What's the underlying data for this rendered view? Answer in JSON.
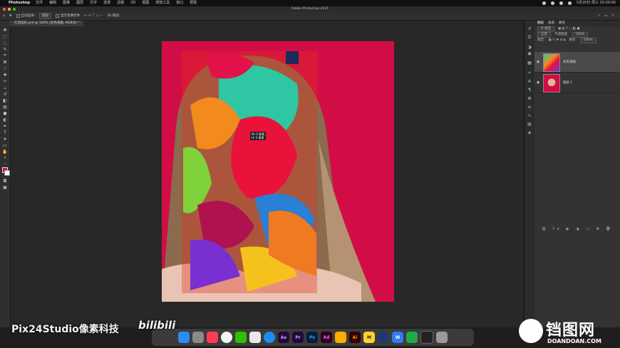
{
  "menubar": {
    "app_name": "Photoshop",
    "items": [
      "文件",
      "编辑",
      "图像",
      "图层",
      "文字",
      "选择",
      "滤镜",
      "3D",
      "视图",
      "增效工具",
      "窗口",
      "帮助"
    ],
    "clock": "5月20日 周三 20:00:00"
  },
  "window": {
    "title": "Adobe Photoshop 2021"
  },
  "options_bar": {
    "auto_select_label": "自动选择:",
    "auto_select_value": "图层",
    "show_transform_label": "显示变换控件",
    "mode_3d_label": "3D 模式:"
  },
  "document_tab": {
    "label": "打造炫彩.psd @ 100% (彩色海报, RGB/8) *"
  },
  "canvas": {
    "tooltip_line1": "W: 0 像素",
    "tooltip_line2": "H: 0 像素",
    "background_color": "#d20d45"
  },
  "layers_panel": {
    "tabs": [
      "图层",
      "通道",
      "路径"
    ],
    "kind_filter": "Q 类型",
    "blend_mode": "正常",
    "opacity_label": "不透明度:",
    "opacity_value": "100%",
    "lock_label": "锁定:",
    "fill_label": "填充:",
    "fill_value": "100%",
    "layers": [
      {
        "name": "彩色海报",
        "selected": true
      },
      {
        "name": "图层 1",
        "selected": false
      }
    ]
  },
  "dock": {
    "apps": [
      "finder-icon",
      "launchpad-icon",
      "music-icon",
      "chrome-icon",
      "wechat-icon",
      "qq-icon",
      "safari-icon",
      "after-effects-icon",
      "premiere-icon",
      "photoshop-icon",
      "xd-icon",
      "sketch-icon",
      "illustrator-icon",
      "miro-icon",
      "cinema4d-icon",
      "wps-icon",
      "camtasia-icon",
      "terminal-icon",
      "trash-icon"
    ],
    "labels": [
      "",
      "",
      "",
      "",
      "",
      "",
      "",
      "Ae",
      "Pr",
      "Ps",
      "Xd",
      "",
      "Ai",
      "M",
      "",
      "W",
      "",
      "",
      ""
    ]
  },
  "watermarks": {
    "left": "Pix24Studio像素科技",
    "bili": "bilibili",
    "brand": "铛图网",
    "domain": "DOANDOAN.COM"
  },
  "colors": {
    "accent_red": "#d20d45",
    "panel_bg": "#333333"
  }
}
